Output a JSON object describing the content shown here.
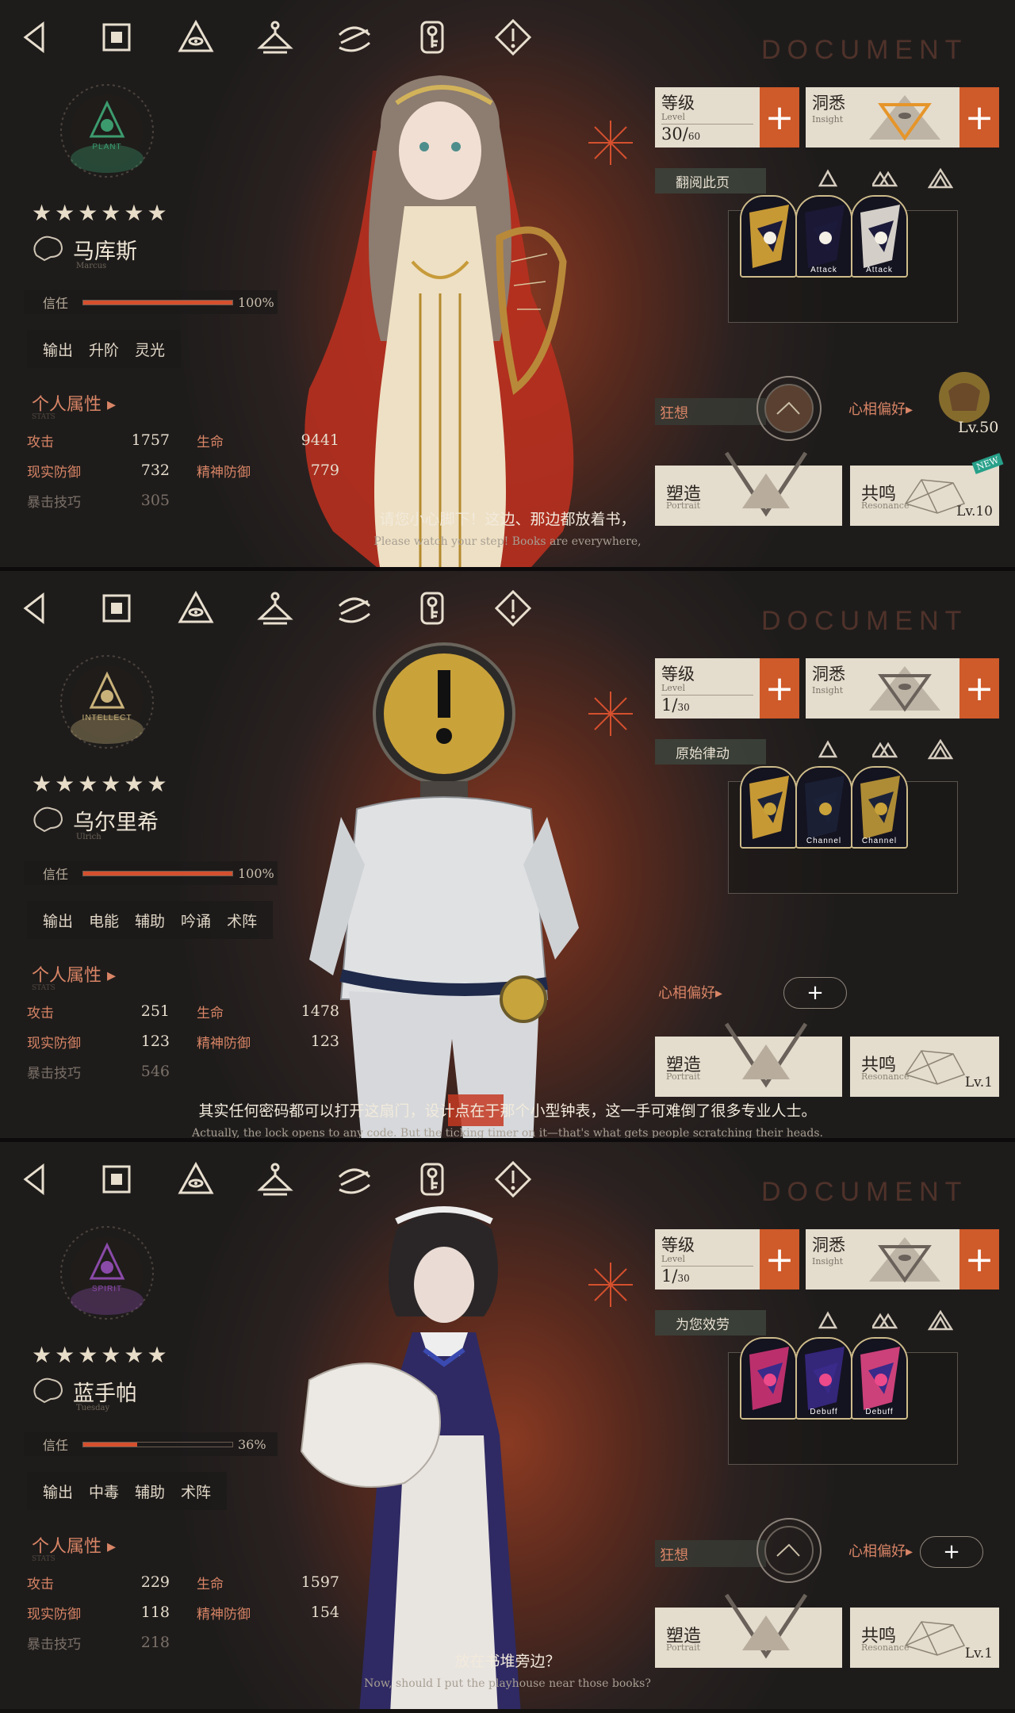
{
  "nav": {
    "icons": [
      "back-icon",
      "home-icon",
      "eye-triangle-icon",
      "wardrobe-icon",
      "pattern-icon",
      "key-icon",
      "alert-icon"
    ]
  },
  "watermark": "DOCUMENT",
  "common": {
    "trust_label": "信任",
    "attributes_label": "个人属性 ▸",
    "attributes_sub": "STATS",
    "stat_labels": {
      "atk": "攻击",
      "hp": "生命",
      "rdef": "现实防御",
      "mdef": "精神防御",
      "crit": "暴击技巧"
    },
    "level_label": "等级",
    "level_en": "Level",
    "insight_label": "洞悉",
    "insight_en": "Insight",
    "mania_label": "狂想",
    "pref_label": "心相偏好▸",
    "portrait_label": "塑造",
    "portrait_en": "Portrait",
    "resonance_label": "共鸣",
    "resonance_en": "Resonance"
  },
  "characters": [
    {
      "afflatus": "PLANT",
      "afflatus_color": "#3c9b6e",
      "stars": "★★★★★★",
      "name": "马库斯",
      "name_en": "Marcus",
      "trust_pct": "100%",
      "trust_value": 1.0,
      "tags": [
        "输出",
        "升阶",
        "灵光"
      ],
      "stats": {
        "atk": "1757",
        "hp": "9441",
        "rdef": "732",
        "mdef": "779",
        "crit": "305"
      },
      "level": "30",
      "level_max": "60",
      "skill_name": "翻阅此页",
      "card_labels": [
        "",
        "Attack",
        "Attack"
      ],
      "pref_level": "Lv.50",
      "resonance_level": "Lv.10",
      "new_badge": "NEW",
      "subtitle_zh": "请您小心脚下！这边、那边都放着书，",
      "subtitle_en": "Please watch your step! Books are everywhere,"
    },
    {
      "afflatus": "INTELLECT",
      "afflatus_color": "#c9b27a",
      "stars": "★★★★★★",
      "name": "乌尔里希",
      "name_en": "Ulrich",
      "trust_pct": "100%",
      "trust_value": 1.0,
      "tags": [
        "输出",
        "电能",
        "辅助",
        "吟诵",
        "术阵"
      ],
      "stats": {
        "atk": "251",
        "hp": "1478",
        "rdef": "123",
        "mdef": "123",
        "crit": "546"
      },
      "level": "1",
      "level_max": "30",
      "skill_name": "原始律动",
      "card_labels": [
        "",
        "Channel",
        "Channel"
      ],
      "resonance_level": "Lv.1",
      "subtitle_zh": "其实任何密码都可以打开这扇门，设计点在于那个小型钟表，这一手可难倒了很多专业人士。",
      "subtitle_en": "Actually, the lock opens to any code. But the ticking timer on it—that's what gets people scratching their heads."
    },
    {
      "afflatus": "SPIRIT",
      "afflatus_color": "#8a4aa8",
      "stars": "★★★★★★",
      "name": "蓝手帕",
      "name_en": "Tuesday",
      "trust_pct": "36%",
      "trust_value": 0.36,
      "tags": [
        "输出",
        "中毒",
        "辅助",
        "术阵"
      ],
      "stats": {
        "atk": "229",
        "hp": "1597",
        "rdef": "118",
        "mdef": "154",
        "crit": "218"
      },
      "level": "1",
      "level_max": "30",
      "skill_name": "为您效劳",
      "card_labels": [
        "",
        "Debuff",
        "Debuff"
      ],
      "resonance_level": "Lv.1",
      "subtitle_zh": "放在书堆旁边？",
      "subtitle_en": "Now, should I put the playhouse near those books?"
    }
  ]
}
